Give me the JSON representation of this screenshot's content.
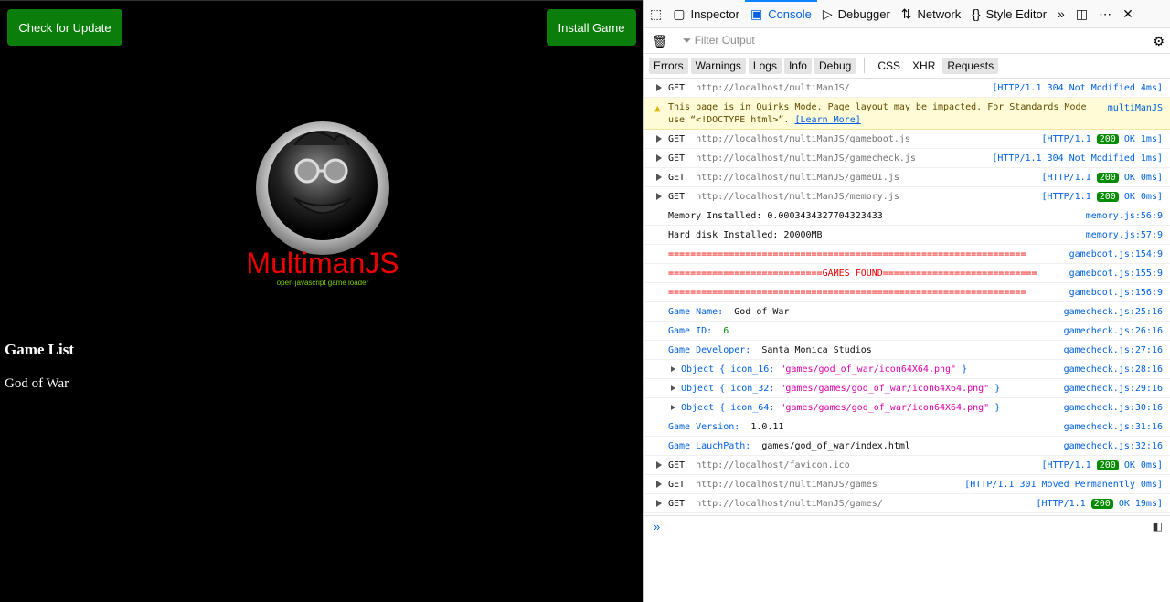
{
  "page": {
    "check_update": "Check for Update",
    "install_game": "Install Game",
    "logo_text": "MultimanJS",
    "logo_sub": "open javascript game loader",
    "game_list_title": "Game List",
    "games": [
      "God of War"
    ]
  },
  "devtools": {
    "tabs": [
      {
        "label": "Inspector",
        "icon": "inspector-icon"
      },
      {
        "label": "Console",
        "icon": "console-icon",
        "selected": true
      },
      {
        "label": "Debugger",
        "icon": "debugger-icon"
      },
      {
        "label": "Network",
        "icon": "network-icon"
      },
      {
        "label": "Style Editor",
        "icon": "style-editor-icon"
      }
    ],
    "filter_placeholder": "Filter Output",
    "categories": [
      "Errors",
      "Warnings",
      "Logs",
      "Info",
      "Debug",
      "CSS",
      "XHR",
      "Requests"
    ],
    "log": [
      {
        "kind": "net",
        "method": "GET",
        "url": "http://localhost/multiManJS/",
        "status": "[HTTP/1.1 304 Not Modified 4ms]"
      },
      {
        "kind": "warn",
        "text": "This page is in Quirks Mode. Page layout may be impacted. For Standards Mode use “<!DOCTYPE html>”.",
        "link": "[Learn More]",
        "src": "multiManJS"
      },
      {
        "kind": "net",
        "method": "GET",
        "url": "http://localhost/multiManJS/gameboot.js",
        "pre": "[HTTP/1.1",
        "code": "200",
        "post": "OK 1ms]"
      },
      {
        "kind": "net",
        "method": "GET",
        "url": "http://localhost/multiManJS/gamecheck.js",
        "status": "[HTTP/1.1 304 Not Modified 1ms]"
      },
      {
        "kind": "net",
        "method": "GET",
        "url": "http://localhost/multiManJS/gameUI.js",
        "pre": "[HTTP/1.1",
        "code": "200",
        "post": "OK 0ms]"
      },
      {
        "kind": "net",
        "method": "GET",
        "url": "http://localhost/multiManJS/memory.js",
        "pre": "[HTTP/1.1",
        "code": "200",
        "post": "OK 0ms]"
      },
      {
        "kind": "log",
        "text": "Memory Installed: 0.0003434327704323433",
        "src": "memory.js:56:9"
      },
      {
        "kind": "log",
        "text": "Hard disk Installed: 20000MB",
        "src": "memory.js:57:9"
      },
      {
        "kind": "red",
        "text": "=================================================================",
        "src": "gameboot.js:154:9"
      },
      {
        "kind": "red",
        "text": "============================GAMES FOUND============================",
        "src": "gameboot.js:155:9"
      },
      {
        "kind": "red",
        "text": "=================================================================",
        "src": "gameboot.js:156:9"
      },
      {
        "kind": "kv",
        "key": "Game Name:",
        "value": "God of War",
        "src": "gamecheck.js:25:16"
      },
      {
        "kind": "kv",
        "key": "Game ID:",
        "value": "6",
        "num": true,
        "src": "gamecheck.js:26:16"
      },
      {
        "kind": "kv",
        "key": "Game Developer:",
        "value": "Santa Monica Studios",
        "src": "gamecheck.js:27:16"
      },
      {
        "kind": "obj",
        "key": "icon_16:",
        "value": "\"games/god_of_war/icon64X64.png\"",
        "src": "gamecheck.js:28:16"
      },
      {
        "kind": "obj",
        "key": "icon_32:",
        "value": "\"games/games/god_of_war/icon64X64.png\"",
        "src": "gamecheck.js:29:16"
      },
      {
        "kind": "obj",
        "key": "icon_64:",
        "value": "\"games/games/god_of_war/icon64X64.png\"",
        "src": "gamecheck.js:30:16"
      },
      {
        "kind": "kv",
        "key": "Game Version:",
        "value": "1.0.11",
        "src": "gamecheck.js:31:16"
      },
      {
        "kind": "kv",
        "key": "Game LauchPath:",
        "value": "games/god_of_war/index.html",
        "src": "gamecheck.js:32:16"
      },
      {
        "kind": "net",
        "method": "GET",
        "url": "http://localhost/favicon.ico",
        "pre": "[HTTP/1.1",
        "code": "200",
        "post": "OK 0ms]"
      },
      {
        "kind": "net",
        "method": "GET",
        "url": "http://localhost/multiManJS/games",
        "status": "[HTTP/1.1 301 Moved Permanently 0ms]"
      },
      {
        "kind": "net",
        "method": "GET",
        "url": "http://localhost/multiManJS/games/",
        "pre": "[HTTP/1.1",
        "code": "200",
        "post": "OK 19ms]"
      }
    ],
    "prompt": "»"
  }
}
